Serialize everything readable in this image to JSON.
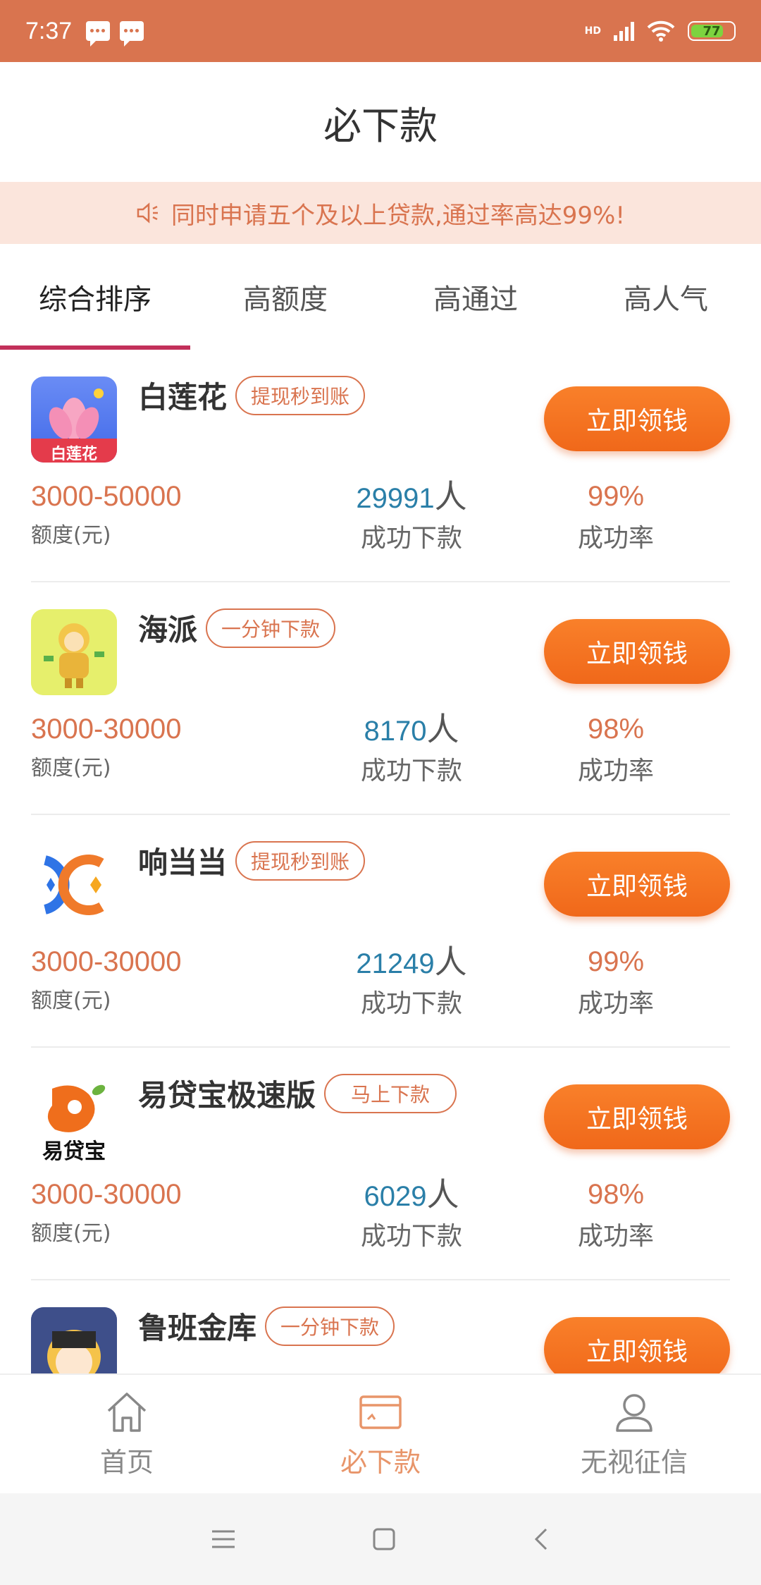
{
  "status_bar": {
    "time": "7:37",
    "network": "HD",
    "battery": "77"
  },
  "header": {
    "title": "必下款"
  },
  "notice": {
    "text": "同时申请五个及以上贷款,通过率高达99%!"
  },
  "tabs": [
    {
      "label": "综合排序",
      "active": true
    },
    {
      "label": "高额度",
      "active": false
    },
    {
      "label": "高通过",
      "active": false
    },
    {
      "label": "高人气",
      "active": false
    }
  ],
  "loans": [
    {
      "name": "白莲花",
      "tag": "提现秒到账",
      "button": "立即领钱",
      "amount": "3000-50000",
      "amount_label": "额度(元)",
      "success_count": "29991",
      "count_unit": "人",
      "success_label": "成功下款",
      "rate": "99%",
      "rate_label": "成功率",
      "logo_text": "白莲花"
    },
    {
      "name": "海派",
      "tag": "一分钟下款",
      "button": "立即领钱",
      "amount": "3000-30000",
      "amount_label": "额度(元)",
      "success_count": "8170",
      "count_unit": "人",
      "success_label": "成功下款",
      "rate": "98%",
      "rate_label": "成功率"
    },
    {
      "name": "响当当",
      "tag": "提现秒到账",
      "button": "立即领钱",
      "amount": "3000-30000",
      "amount_label": "额度(元)",
      "success_count": "21249",
      "count_unit": "人",
      "success_label": "成功下款",
      "rate": "99%",
      "rate_label": "成功率"
    },
    {
      "name": "易贷宝极速版",
      "tag": "马上下款",
      "button": "立即领钱",
      "amount": "3000-30000",
      "amount_label": "额度(元)",
      "success_count": "6029",
      "count_unit": "人",
      "success_label": "成功下款",
      "rate": "98%",
      "rate_label": "成功率",
      "logo_text": "易贷宝"
    },
    {
      "name": "鲁班金库",
      "tag": "一分钟下款",
      "button": "立即领钱"
    }
  ],
  "bottom_nav": [
    {
      "label": "首页",
      "icon": "home-icon",
      "active": false
    },
    {
      "label": "必下款",
      "icon": "card-icon",
      "active": true
    },
    {
      "label": "无视征信",
      "icon": "user-icon",
      "active": false
    }
  ],
  "colors": {
    "accent": "#d9744f",
    "button": "#f4761f",
    "tab_indicator": "#c2305a",
    "count_blue": "#2a7fa8"
  }
}
